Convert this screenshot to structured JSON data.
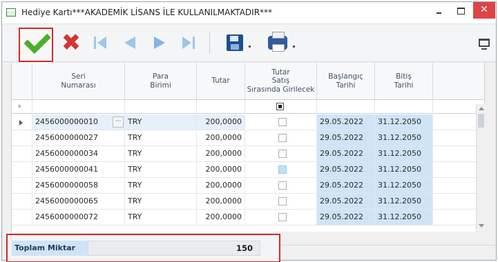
{
  "window": {
    "title": "Hediye Kartı***AKADEMİK LİSANS İLE KULLANILMAKTADIR***",
    "close_label": "✕"
  },
  "toolbar": {
    "cancel_label": "✖"
  },
  "grid": {
    "columns": [
      {
        "key": "seri",
        "label": "Seri\nNumarası"
      },
      {
        "key": "para",
        "label": "Para\nBirimi"
      },
      {
        "key": "tutar",
        "label": "Tutar"
      },
      {
        "key": "satis",
        "label": "Tutar\nSatış\nSırasında Girilecek"
      },
      {
        "key": "baslangic",
        "label": "Başlangıç\nTarihi"
      },
      {
        "key": "bitis",
        "label": "Bitiş\nTarihi"
      }
    ],
    "filter_pin": "₉",
    "ellipsis": "···",
    "rows": [
      {
        "seri": "2456000000010",
        "para": "TRY",
        "tutar": "200,0000",
        "satis": false,
        "baslangic": "29.05.2022",
        "bitis": "31.12.2050"
      },
      {
        "seri": "2456000000027",
        "para": "TRY",
        "tutar": "200,0000",
        "satis": false,
        "baslangic": "29.05.2022",
        "bitis": "31.12.2050"
      },
      {
        "seri": "2456000000034",
        "para": "TRY",
        "tutar": "200,0000",
        "satis": false,
        "baslangic": "29.05.2022",
        "bitis": "31.12.2050"
      },
      {
        "seri": "2456000000041",
        "para": "TRY",
        "tutar": "200,0000",
        "satis": false,
        "baslangic": "29.05.2022",
        "bitis": "31.12.2050"
      },
      {
        "seri": "2456000000058",
        "para": "TRY",
        "tutar": "200,0000",
        "satis": false,
        "baslangic": "29.05.2022",
        "bitis": "31.12.2050"
      },
      {
        "seri": "2456000000065",
        "para": "TRY",
        "tutar": "200,0000",
        "satis": false,
        "baslangic": "29.05.2022",
        "bitis": "31.12.2050"
      },
      {
        "seri": "2456000000072",
        "para": "TRY",
        "tutar": "200,0000",
        "satis": false,
        "baslangic": "29.05.2022",
        "bitis": "31.12.2050"
      }
    ]
  },
  "footer": {
    "total_label": "Toplam Miktar",
    "total_value": "150"
  },
  "colors": {
    "accent_red": "#d72828",
    "approve_green": "#4caf2b",
    "date_cell_bg": "#cfe5f7"
  }
}
